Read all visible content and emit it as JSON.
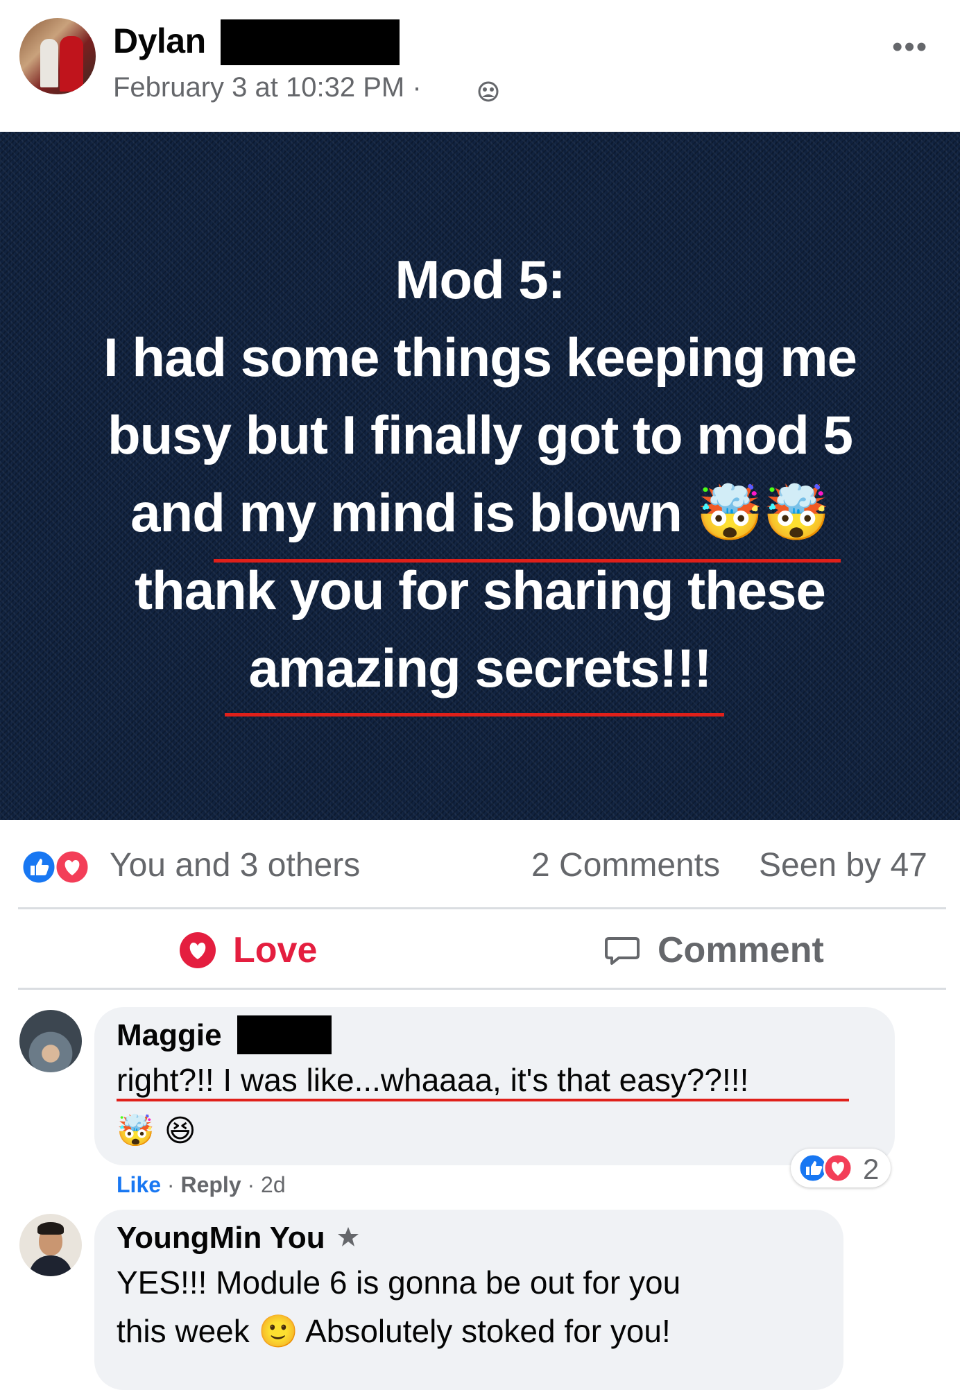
{
  "post": {
    "author_name": "Dylan",
    "timestamp": "February 3 at 10:32 PM ·",
    "more_label": "•••"
  },
  "banner": {
    "line1": "Mod 5:",
    "line2": "I had some things keeping me",
    "line3": "busy but I finally got to mod 5",
    "line4_text": "and my mind is blown ",
    "line4_emoji": "🤯🤯",
    "line5": "thank you for sharing these",
    "line6": "amazing secrets!!!",
    "background_color": "#10213d",
    "underline_color": "#e0201a"
  },
  "reactions": {
    "summary": "You and 3 others",
    "comments_count": "2 Comments",
    "seen_by": "Seen by 47",
    "like_color": "#1877f2",
    "love_color": "#f33e58"
  },
  "actions": {
    "love_label": "Love",
    "comment_label": "Comment",
    "love_color": "#e41e3f"
  },
  "comments": [
    {
      "author": "Maggie",
      "text": "right?!! I was like...whaaaa, it's that easy??!!!",
      "emoji": "🤯 😆",
      "like_label": "Like",
      "reply_label": "Reply",
      "age": "2d",
      "reaction_count": "2"
    },
    {
      "author": "YoungMin You",
      "line1": "YES!!! Module 6 is gonna be out for you",
      "line2_a": "this week ",
      "line2_emoji": "🙂",
      "line2_b": " Absolutely stoked for you!"
    }
  ]
}
